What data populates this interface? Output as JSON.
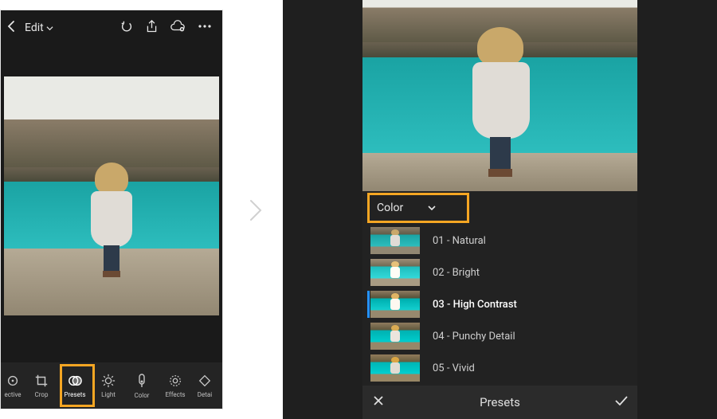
{
  "left": {
    "edit_label": "Edit",
    "tools": {
      "selective": "ective",
      "crop": "Crop",
      "presets": "Presets",
      "light": "Light",
      "color": "Color",
      "effects": "Effects",
      "detail": "Detai"
    }
  },
  "right": {
    "category": "Color",
    "presets": [
      {
        "label": "01 - Natural"
      },
      {
        "label": "02 - Bright"
      },
      {
        "label": "03 - High Contrast"
      },
      {
        "label": "04 - Punchy Detail"
      },
      {
        "label": "05 - Vivid"
      }
    ],
    "panel_title": "Presets"
  }
}
